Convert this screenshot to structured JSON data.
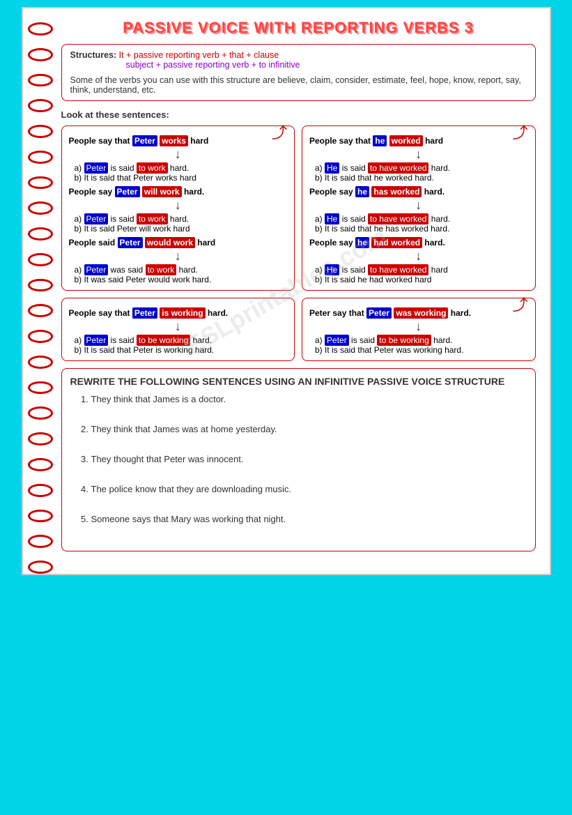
{
  "title": "PASSIVE VOICE WITH REPORTING VERBS 3",
  "structures": {
    "label": "Structures:",
    "formula1": "It + passive reporting verb + that + clause",
    "formula2": "subject + passive reporting verb + to infinitive",
    "description": "Some of the verbs you can use with this structure are believe, claim, consider, estimate, feel, hope, know, report, say, think, understand, etc."
  },
  "look_heading": "Look at these sentences:",
  "box1": {
    "line1_pre": "People say that ",
    "line1_name": "Peter",
    "line1_verb": "works",
    "line1_post": " hard",
    "a1_pre": "a) ",
    "a1_name": "Peter",
    "a1_verb2": "is said",
    "a1_verb3": "to work",
    "a1_post": " hard.",
    "b1": "b) It is said that Peter works hard",
    "line2_pre": "People say ",
    "line2_name": "Peter",
    "line2_verb": "will work",
    "line2_post": " hard.",
    "a2_name": "Peter",
    "a2_verb2": "is said",
    "a2_verb3": "to work",
    "a2_post": " hard.",
    "b2": "b) It is said Peter will work hard",
    "line3_pre": "People said ",
    "line3_name": "Peter",
    "line3_verb": "would work",
    "line3_post": " hard",
    "a3_name": "Peter",
    "a3_verb2": "was said",
    "a3_verb3": "to work",
    "a3_post": " hard.",
    "b3": "b) It was said Peter would work hard."
  },
  "box2": {
    "line1_pre": "People say that ",
    "line1_name": "he",
    "line1_verb": "worked",
    "line1_post": " hard",
    "a1_name": "He",
    "a1_verb3": "to have worked",
    "a1_post": " hard.",
    "b1": "b) It is said that he worked hard.",
    "line2_pre": "People say ",
    "line2_name": "he",
    "line2_verb": "has worked",
    "line2_post": " hard.",
    "a2_name": "He",
    "a2_verb3": "to have worked",
    "a2_post": " hard.",
    "b2": "b) It is said that he has worked hard.",
    "line3_pre": "People say ",
    "line3_name": "he",
    "line3_verb": "had worked",
    "line3_post": " hard.",
    "a3_name": "He",
    "a3_verb3": "to have worked",
    "a3_post": " hard",
    "b3": "b) It is said he had worked hard"
  },
  "box3": {
    "line1_pre": "People say that ",
    "line1_name": "Peter",
    "line1_verb": "is working",
    "line1_post": " hard.",
    "a1_name": "Peter",
    "a1_verb3": "to be working",
    "a1_post": " hard.",
    "b1": "b) It is said that Peter is working hard."
  },
  "box4": {
    "line1_pre": "Peter say that ",
    "line1_name": "Peter",
    "line1_verb": "was working",
    "line1_post": " hard.",
    "a1_name": "Peter",
    "a1_verb3": "to be working",
    "a1_post": " hard.",
    "b1": "b) It is said that Peter was working hard."
  },
  "rewrite": {
    "heading": "REWRITE THE FOLLOWING SENTENCES USING AN INFINITIVE PASSIVE VOICE STRUCTURE",
    "sentences": [
      "They think that James is a doctor.",
      "They think that James was at home yesterday.",
      "They thought that Peter was innocent.",
      "The police know that they are downloading music.",
      "Someone says that Mary was working that night."
    ]
  },
  "spiral_count": 22,
  "watermark": "ESLprintables.com"
}
